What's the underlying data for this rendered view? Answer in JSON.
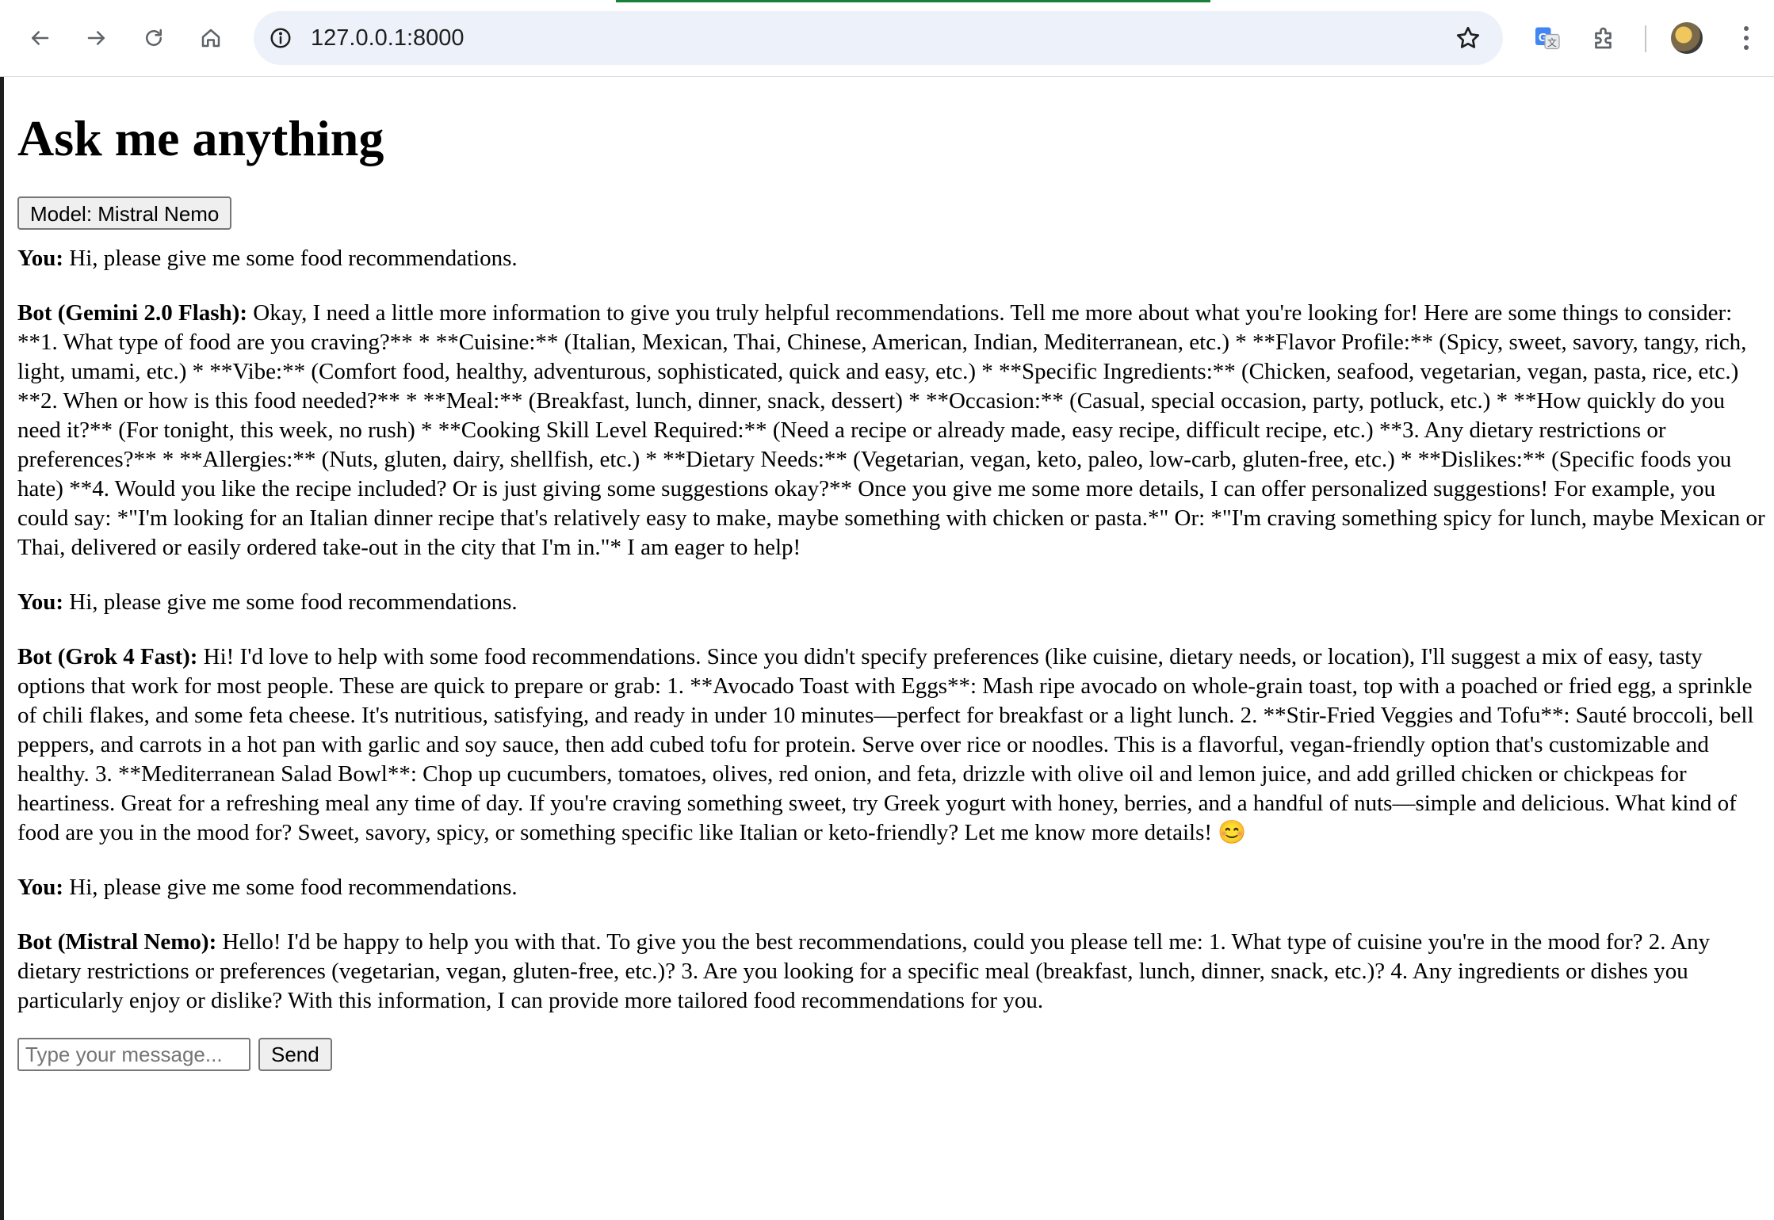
{
  "browser": {
    "url": "127.0.0.1:8000",
    "icons": [
      "back-icon",
      "forward-icon",
      "reload-icon",
      "home-icon",
      "site-info-icon",
      "bookmark-star-icon",
      "translate-icon",
      "extensions-icon",
      "profile-avatar",
      "menu-kebab-icon"
    ]
  },
  "page": {
    "title": "Ask me anything",
    "model_button_label": "Model: Mistral Nemo"
  },
  "messages": [
    {
      "speaker": "You:",
      "text": "Hi, please give me some food recommendations."
    },
    {
      "speaker": "Bot (Gemini 2.0 Flash):",
      "text": "Okay, I need a little more information to give you truly helpful recommendations. Tell me more about what you're looking for! Here are some things to consider: **1. What type of food are you craving?** * **Cuisine:** (Italian, Mexican, Thai, Chinese, American, Indian, Mediterranean, etc.) * **Flavor Profile:** (Spicy, sweet, savory, tangy, rich, light, umami, etc.) * **Vibe:** (Comfort food, healthy, adventurous, sophisticated, quick and easy, etc.) * **Specific Ingredients:** (Chicken, seafood, vegetarian, vegan, pasta, rice, etc.) **2. When or how is this food needed?** * **Meal:** (Breakfast, lunch, dinner, snack, dessert) * **Occasion:** (Casual, special occasion, party, potluck, etc.) * **How quickly do you need it?** (For tonight, this week, no rush) * **Cooking Skill Level Required:** (Need a recipe or already made, easy recipe, difficult recipe, etc.) **3. Any dietary restrictions or preferences?** * **Allergies:** (Nuts, gluten, dairy, shellfish, etc.) * **Dietary Needs:** (Vegetarian, vegan, keto, paleo, low-carb, gluten-free, etc.) * **Dislikes:** (Specific foods you hate) **4. Would you like the recipe included? Or is just giving some suggestions okay?** Once you give me some more details, I can offer personalized suggestions! For example, you could say: *\"I'm looking for an Italian dinner recipe that's relatively easy to make, maybe something with chicken or pasta.*\" Or: *\"I'm craving something spicy for lunch, maybe Mexican or Thai, delivered or easily ordered take-out in the city that I'm in.\"* I am eager to help!"
    },
    {
      "speaker": "You:",
      "text": "Hi, please give me some food recommendations."
    },
    {
      "speaker": "Bot (Grok 4 Fast):",
      "text": "Hi! I'd love to help with some food recommendations. Since you didn't specify preferences (like cuisine, dietary needs, or location), I'll suggest a mix of easy, tasty options that work for most people. These are quick to prepare or grab: 1. **Avocado Toast with Eggs**: Mash ripe avocado on whole-grain toast, top with a poached or fried egg, a sprinkle of chili flakes, and some feta cheese. It's nutritious, satisfying, and ready in under 10 minutes—perfect for breakfast or a light lunch. 2. **Stir-Fried Veggies and Tofu**: Sauté broccoli, bell peppers, and carrots in a hot pan with garlic and soy sauce, then add cubed tofu for protein. Serve over rice or noodles. This is a flavorful, vegan-friendly option that's customizable and healthy. 3. **Mediterranean Salad Bowl**: Chop up cucumbers, tomatoes, olives, red onion, and feta, drizzle with olive oil and lemon juice, and add grilled chicken or chickpeas for heartiness. Great for a refreshing meal any time of day. If you're craving something sweet, try Greek yogurt with honey, berries, and a handful of nuts—simple and delicious. What kind of food are you in the mood for? Sweet, savory, spicy, or something specific like Italian or keto-friendly? Let me know more details! 😊"
    },
    {
      "speaker": "You:",
      "text": "Hi, please give me some food recommendations."
    },
    {
      "speaker": "Bot (Mistral Nemo):",
      "text": "Hello! I'd be happy to help you with that. To give you the best recommendations, could you please tell me: 1. What type of cuisine you're in the mood for? 2. Any dietary restrictions or preferences (vegetarian, vegan, gluten-free, etc.)? 3. Are you looking for a specific meal (breakfast, lunch, dinner, snack, etc.)? 4. Any ingredients or dishes you particularly enjoy or dislike? With this information, I can provide more tailored food recommendations for you."
    }
  ],
  "composer": {
    "placeholder": "Type your message...",
    "value": "",
    "send_label": "Send"
  }
}
